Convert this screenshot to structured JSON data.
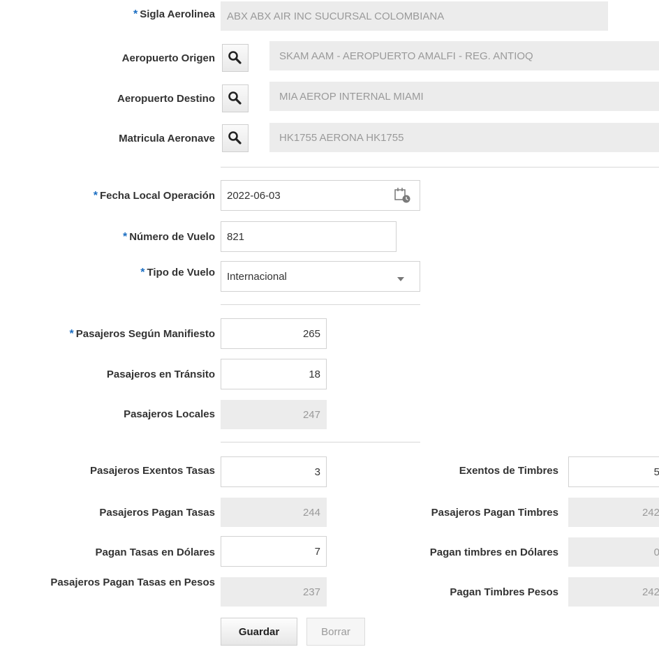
{
  "form": {
    "aerolinea": {
      "label": "Sigla Aerolinea",
      "value": "ABX ABX AIR INC SUCURSAL COLOMBIANA"
    },
    "origen": {
      "label": "Aeropuerto Origen",
      "value": "SKAM AAM - AEROPUERTO AMALFI - REG. ANTIOQ"
    },
    "destino": {
      "label": "Aeropuerto Destino",
      "value": "MIA AEROP INTERNAL MIAMI"
    },
    "matricula": {
      "label": "Matricula Aeronave",
      "value": "HK1755 AERONA HK1755"
    },
    "fecha": {
      "label": "Fecha Local Operación",
      "value": "2022-06-03"
    },
    "vuelo": {
      "label": "Número de Vuelo",
      "value": "821"
    },
    "tipo": {
      "label": "Tipo de Vuelo",
      "value": "Internacional"
    },
    "manifiesto": {
      "label": "Pasajeros Según Manifiesto",
      "value": "265"
    },
    "transito": {
      "label": "Pasajeros en Tránsito",
      "value": "18"
    },
    "locales": {
      "label": "Pasajeros Locales",
      "value": "247"
    },
    "exentos_tasas": {
      "label": "Pasajeros Exentos Tasas",
      "value": "3"
    },
    "pagan_tasas": {
      "label": "Pasajeros Pagan Tasas",
      "value": "244"
    },
    "tasas_dolares": {
      "label": "Pagan Tasas en Dólares",
      "value": "7"
    },
    "tasas_pesos": {
      "label": "Pasajeros Pagan Tasas en Pesos",
      "value": "237"
    },
    "exentos_timbres": {
      "label": "Exentos de Timbres",
      "value": "5"
    },
    "pagan_timbres": {
      "label": "Pasajeros Pagan Timbres",
      "value": "242"
    },
    "timbres_dolares": {
      "label": "Pagan timbres en Dólares",
      "value": "0"
    },
    "timbres_pesos": {
      "label": "Pagan Timbres Pesos",
      "value": "242"
    }
  },
  "buttons": {
    "save": "Guardar",
    "clear": "Borrar"
  },
  "required_marker": "*",
  "icons": {
    "lov": "search-icon",
    "date": "calendar-icon",
    "select": "chevron-down-icon"
  },
  "colors": {
    "required": "#1b6ec2",
    "readonly_bg": "#ececec",
    "border": "#d2d2d2"
  }
}
